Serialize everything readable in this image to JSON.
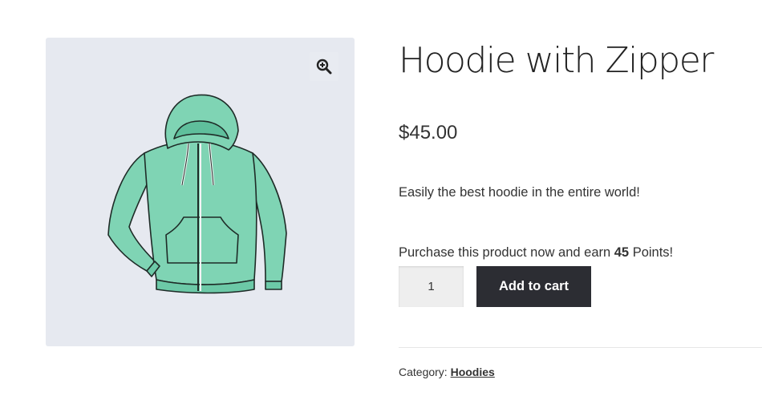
{
  "gallery": {
    "zoom_icon": "magnifier-plus-icon",
    "image_subject": "hoodie-illustration"
  },
  "product": {
    "title": "Hoodie with Zipper",
    "price": "$45.00",
    "short_description": "Easily the best hoodie in the entire world!",
    "points_prefix": "Purchase this product now and earn ",
    "points_value": "45",
    "points_suffix": " Points!"
  },
  "cart_form": {
    "quantity": "1",
    "add_to_cart_label": "Add to cart"
  },
  "meta": {
    "category_label": "Category: ",
    "category_link": "Hoodies"
  },
  "colors": {
    "button_bg": "#2c2d33",
    "gallery_bg": "#e6e9f0",
    "hoodie_fill": "#7fd4b4"
  }
}
